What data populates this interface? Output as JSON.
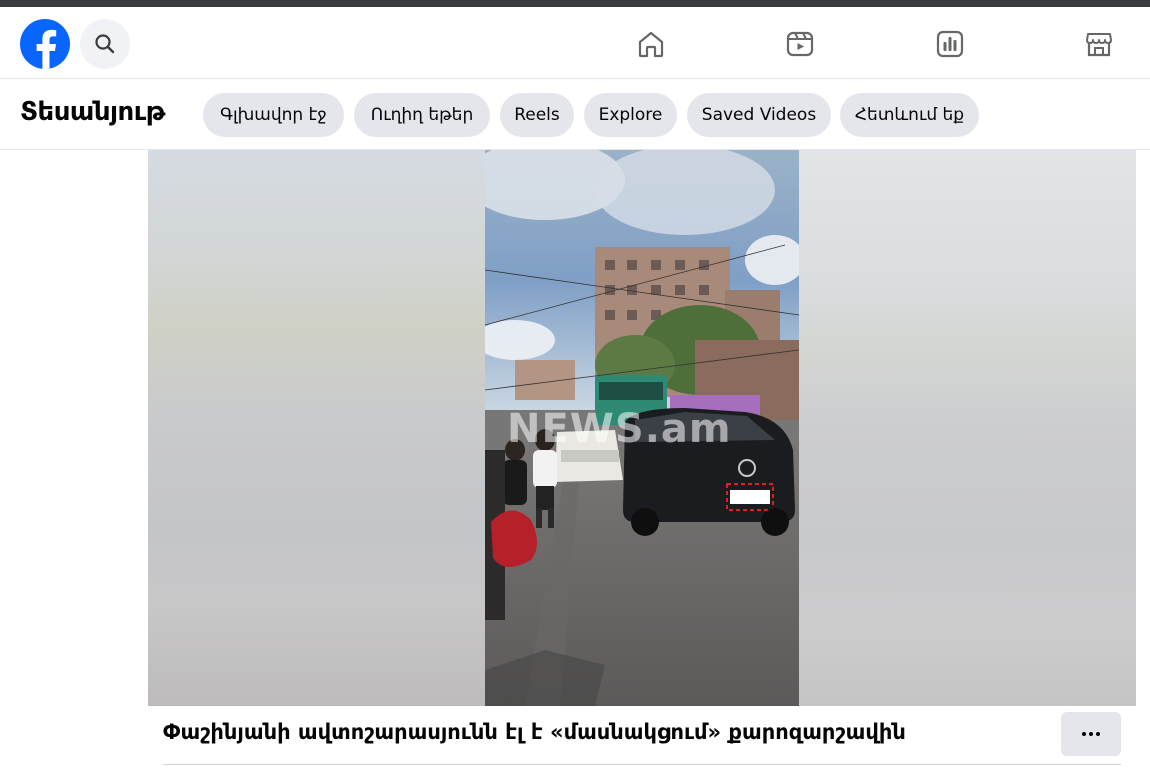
{
  "topnav": {
    "logo_icon": "facebook-logo-icon",
    "search_icon": "search-icon",
    "nav_icons": [
      "home-icon",
      "video-icon",
      "feed-icon",
      "marketplace-icon"
    ]
  },
  "subnav": {
    "title": "Տեսանյութ",
    "pills": [
      "Գլխավոր էջ",
      "Ուղիղ եթեր",
      "Reels",
      "Explore",
      "Saved Videos",
      "Հետևում եք"
    ]
  },
  "video": {
    "watermark": "NEWS.am"
  },
  "post": {
    "caption": "Փաշինյանի ավտոշարասյունն էլ է «մասնակցում» քարոզարշավին",
    "more_icon": "more-icon"
  },
  "colors": {
    "brand": "#0866ff",
    "pill_bg": "#e4e6eb",
    "icon": "#65676b"
  }
}
